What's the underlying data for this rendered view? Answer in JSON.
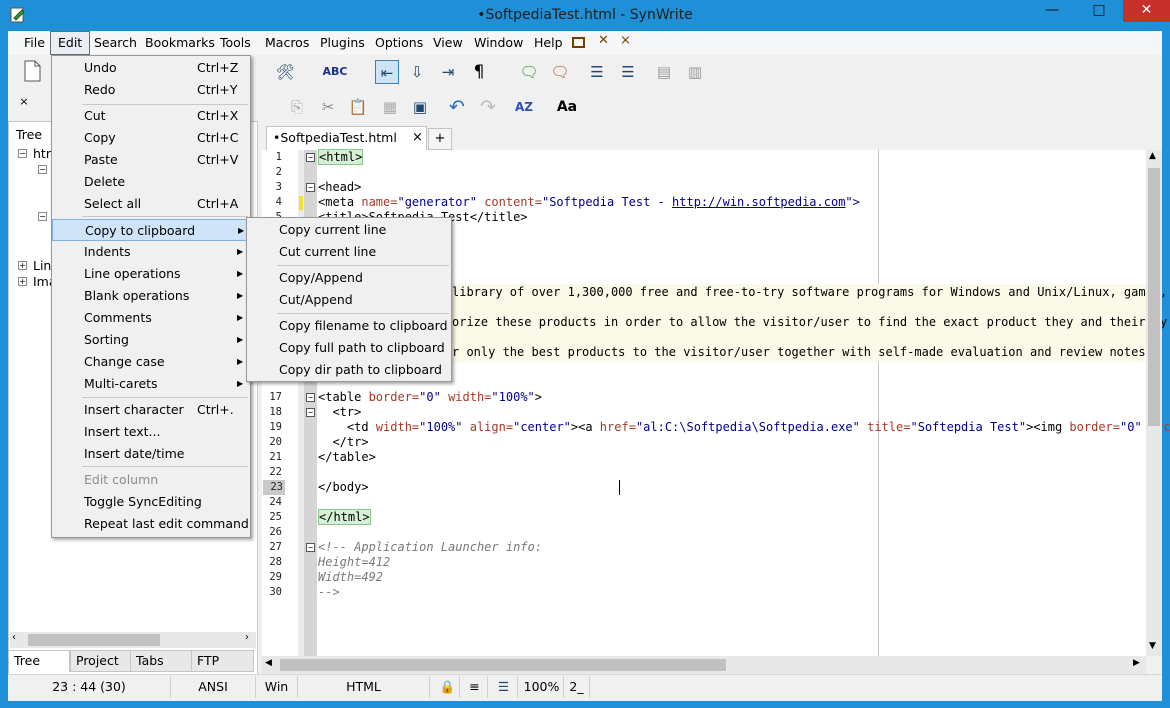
{
  "window": {
    "title": "•SoftpediaTest.html - SynWrite",
    "minimize": "—",
    "maximize": "□",
    "close": "✕"
  },
  "menubar": [
    "File",
    "Edit",
    "Search",
    "Bookmarks",
    "Tools",
    "Macros",
    "Plugins",
    "Options",
    "View",
    "Window",
    "Help"
  ],
  "edit_menu": {
    "items": [
      {
        "label": "Undo",
        "shortcut": "Ctrl+Z"
      },
      {
        "label": "Redo",
        "shortcut": "Ctrl+Y"
      },
      {
        "label": "Cut",
        "shortcut": "Ctrl+X"
      },
      {
        "label": "Copy",
        "shortcut": "Ctrl+C"
      },
      {
        "label": "Paste",
        "shortcut": "Ctrl+V"
      },
      {
        "label": "Delete",
        "shortcut": ""
      },
      {
        "label": "Select all",
        "shortcut": "Ctrl+A"
      },
      {
        "label": "Copy to clipboard",
        "shortcut": ""
      },
      {
        "label": "Indents",
        "shortcut": ""
      },
      {
        "label": "Line operations",
        "shortcut": ""
      },
      {
        "label": "Blank operations",
        "shortcut": ""
      },
      {
        "label": "Comments",
        "shortcut": ""
      },
      {
        "label": "Sorting",
        "shortcut": ""
      },
      {
        "label": "Change case",
        "shortcut": ""
      },
      {
        "label": "Multi-carets",
        "shortcut": ""
      },
      {
        "label": "Insert character",
        "shortcut": "Ctrl+."
      },
      {
        "label": "Insert text...",
        "shortcut": ""
      },
      {
        "label": "Insert date/time",
        "shortcut": ""
      },
      {
        "label": "Edit column",
        "shortcut": ""
      },
      {
        "label": "Toggle SyncEditing",
        "shortcut": ""
      },
      {
        "label": "Repeat last edit command",
        "shortcut": ""
      }
    ]
  },
  "clipboard_submenu": [
    "Copy current line",
    "Cut current line",
    "Copy/Append",
    "Cut/Append",
    "Copy filename to clipboard",
    "Copy full path to clipboard",
    "Copy dir path to clipboard"
  ],
  "left_panel": {
    "header": "Tree",
    "close": "×",
    "nodes": [
      "htm",
      "Lin",
      "Ima"
    ],
    "tabs": [
      "Tree",
      "Project",
      "Tabs",
      "FTP"
    ]
  },
  "editor": {
    "tab_label": "•SoftpediaTest.html",
    "tab_close": "×",
    "tab_add": "+",
    "line_numbers": [
      "1",
      "2",
      "3",
      "4",
      "5",
      "6",
      "7",
      "8",
      "9",
      "10",
      "11",
      "12",
      "13",
      "14",
      "15",
      "16",
      "17",
      "18",
      "19",
      "20",
      "21",
      "22",
      "23",
      "24",
      "25",
      "26",
      "27",
      "28",
      "29",
      "30"
    ],
    "current_line": "23",
    "lines": {
      "l1": "<html>",
      "l3": "<head>",
      "l4a": "<meta ",
      "l4b": "name=",
      "l4c": "\"generator\" ",
      "l4d": "content=",
      "l4e": "\"Softpedia Test - ",
      "l4f": "http://win.softpedia.com",
      "l4g": "\">",
      "l5": "<title>Softpedia Test</title>",
      "l10": "library of over 1,300,000 free and free-to-try software programs for Windows and Unix/Linux, games,",
      "l12": "orize these products in order to allow the visitor/user to find the exact product they and their sy",
      "l14": "r only the best products to the visitor/user together with self-made evaluation and review notes.",
      "l17a": "<table ",
      "l17b": "border=",
      "l17c": "\"0\" ",
      "l17d": "width=",
      "l17e": "\"100%\"",
      "l17f": ">",
      "l18": "  <tr>",
      "l19a": "    <td ",
      "l19b": "width=",
      "l19c": "\"100%\" ",
      "l19d": "align=",
      "l19e": "\"center\"",
      "l19f": "><a ",
      "l19g": "href=",
      "l19h": "\"al:C:\\Softpedia\\Softpedia.exe\" ",
      "l19i": "title=",
      "l19j": "\"Softepdia Test\"",
      "l19k": "><img ",
      "l19l": "border=",
      "l19m": "\"0\" ",
      "l19n": "src",
      "l20": "  </tr>",
      "l21": "</table>",
      "l23": "</body>",
      "l25": "</html>",
      "l27": "<!-- Application Launcher info:",
      "l28": "Height=412",
      "l29": "Width=492",
      "l30": "-->"
    }
  },
  "statusbar": {
    "position": "23 : 44 (30)",
    "encoding": "ANSI",
    "line_ending": "Win",
    "lexer": "HTML",
    "zoom": "100%",
    "extra": "2_"
  },
  "colors": {
    "titlebar": "#1f8fd8",
    "close_button": "#c7312b",
    "menu_highlight": "#cfe4f8",
    "attr": "#a43a2a",
    "value": "#00008b",
    "comment": "#7a7a7a",
    "highlight_row": "#fbf9e8"
  }
}
